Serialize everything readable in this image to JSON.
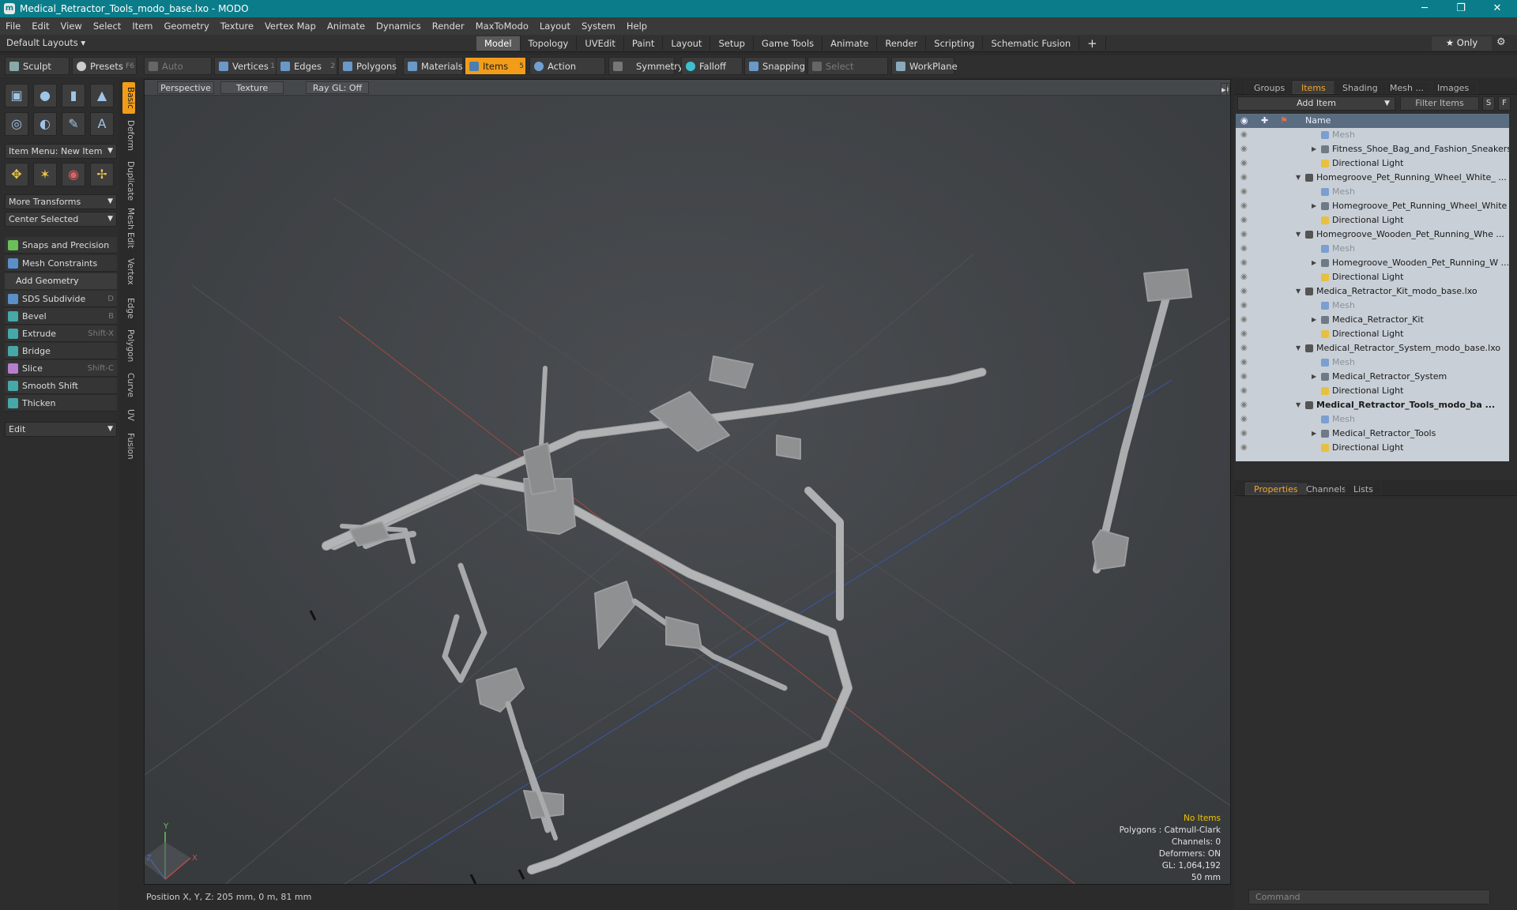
{
  "window": {
    "title": "Medical_Retractor_Tools_modo_base.lxo - MODO",
    "app_icon": "modo-icon",
    "minimize": "─",
    "maximize": "❐",
    "close": "✕"
  },
  "menu": [
    "File",
    "Edit",
    "View",
    "Select",
    "Item",
    "Geometry",
    "Texture",
    "Vertex Map",
    "Animate",
    "Dynamics",
    "Render",
    "MaxToModo",
    "Layout",
    "System",
    "Help"
  ],
  "layouts": {
    "label": "Default Layouts ▾",
    "tabs": [
      "Model",
      "Topology",
      "UVEdit",
      "Paint",
      "Layout",
      "Setup",
      "Game Tools",
      "Animate",
      "Render",
      "Scripting",
      "Schematic Fusion"
    ],
    "active_tab": "Model",
    "add": "+",
    "only_label": "★  Only",
    "gear": "⚙"
  },
  "toolbar": {
    "sculpt": "Sculpt",
    "presets": "Presets",
    "presets_key": "F6",
    "auto_select": "Auto Select",
    "vertices": "Vertices",
    "vertices_num": "1",
    "edges": "Edges",
    "edges_num": "2",
    "polygons": "Polygons",
    "materials": "Materials",
    "items": "Items",
    "items_num": "5",
    "action_center": "Action Center",
    "symmetry": "Symmetry",
    "falloff": "Falloff",
    "snapping": "Snapping",
    "select_through": "Select Through",
    "workplane": "WorkPlane"
  },
  "left": {
    "item_menu": "Item Menu: New Item",
    "more_transforms": "More Transforms",
    "center_selected": "Center Selected",
    "snaps": "Snaps and Precision",
    "mesh_constraints": "Mesh Constraints",
    "add_geometry": "Add Geometry",
    "tools": [
      {
        "label": "SDS Subdivide",
        "shortcut": "D"
      },
      {
        "label": "Bevel",
        "shortcut": "B"
      },
      {
        "label": "Extrude",
        "shortcut": "Shift-X"
      },
      {
        "label": "Bridge",
        "shortcut": ""
      },
      {
        "label": "Slice",
        "shortcut": "Shift-C"
      },
      {
        "label": "Smooth Shift",
        "shortcut": ""
      },
      {
        "label": "Thicken",
        "shortcut": ""
      }
    ],
    "edit": "Edit",
    "vtabs": [
      "Basic",
      "Deform",
      "Duplicate",
      "Mesh Edit",
      "Vertex",
      "Edge",
      "Polygon",
      "Curve",
      "UV",
      "Fusion"
    ]
  },
  "viewport": {
    "perspective": "Perspective",
    "texture": "Texture",
    "raygl": "Ray GL: Off",
    "info": {
      "items": "No Items",
      "polygons": "Polygons : Catmull-Clark",
      "channels": "Channels: 0",
      "deformers": "Deformers: ON",
      "gl": "GL: 1,064,192",
      "size": "50 mm"
    },
    "axis": {
      "x": "X",
      "y": "Y",
      "z": "Z"
    }
  },
  "status": {
    "position": "Position X, Y, Z:  205 mm, 0 m, 81 mm"
  },
  "right": {
    "top_tabs": [
      "Groups",
      "Items",
      "Shading",
      "Mesh ...",
      "Images"
    ],
    "active_top": "Items",
    "add_item": "Add Item",
    "filter": "Filter Items",
    "s": "S",
    "f": "F",
    "name_col": "Name",
    "tree": [
      {
        "label": "Mesh",
        "level": 2,
        "kind": "mesh",
        "dim": true
      },
      {
        "label": "Fitness_Shoe_Bag_and_Fashion_Sneakers",
        "level": 2,
        "kind": "item",
        "expand": "▶"
      },
      {
        "label": "Directional Light",
        "level": 2,
        "kind": "light"
      },
      {
        "label": "Homegroove_Pet_Running_Wheel_White_ ...",
        "level": 1,
        "kind": "scene",
        "expand": "▼"
      },
      {
        "label": "Mesh",
        "level": 2,
        "kind": "mesh",
        "dim": true
      },
      {
        "label": "Homegroove_Pet_Running_Wheel_White",
        "level": 2,
        "kind": "item",
        "expand": "▶"
      },
      {
        "label": "Directional Light",
        "level": 2,
        "kind": "light"
      },
      {
        "label": "Homegroove_Wooden_Pet_Running_Whe ...",
        "level": 1,
        "kind": "scene",
        "expand": "▼"
      },
      {
        "label": "Mesh",
        "level": 2,
        "kind": "mesh",
        "dim": true
      },
      {
        "label": "Homegroove_Wooden_Pet_Running_W ...",
        "level": 2,
        "kind": "item",
        "expand": "▶"
      },
      {
        "label": "Directional Light",
        "level": 2,
        "kind": "light"
      },
      {
        "label": "Medica_Retractor_Kit_modo_base.lxo",
        "level": 1,
        "kind": "scene",
        "expand": "▼"
      },
      {
        "label": "Mesh",
        "level": 2,
        "kind": "mesh",
        "dim": true
      },
      {
        "label": "Medica_Retractor_Kit",
        "level": 2,
        "kind": "item",
        "expand": "▶"
      },
      {
        "label": "Directional Light",
        "level": 2,
        "kind": "light"
      },
      {
        "label": "Medical_Retractor_System_modo_base.lxo",
        "level": 1,
        "kind": "scene",
        "expand": "▼"
      },
      {
        "label": "Mesh",
        "level": 2,
        "kind": "mesh",
        "dim": true
      },
      {
        "label": "Medical_Retractor_System",
        "level": 2,
        "kind": "item",
        "expand": "▶"
      },
      {
        "label": "Directional Light",
        "level": 2,
        "kind": "light"
      },
      {
        "label": "Medical_Retractor_Tools_modo_ba ...",
        "level": 1,
        "kind": "scene",
        "expand": "▼",
        "bold": true
      },
      {
        "label": "Mesh",
        "level": 2,
        "kind": "mesh",
        "dim": true
      },
      {
        "label": "Medical_Retractor_Tools",
        "level": 2,
        "kind": "item",
        "expand": "▶"
      },
      {
        "label": "Directional Light",
        "level": 2,
        "kind": "light"
      }
    ],
    "bottom_tabs": [
      "Properties",
      "Channels",
      "Lists"
    ],
    "active_bottom": "Properties",
    "command": "Command"
  }
}
